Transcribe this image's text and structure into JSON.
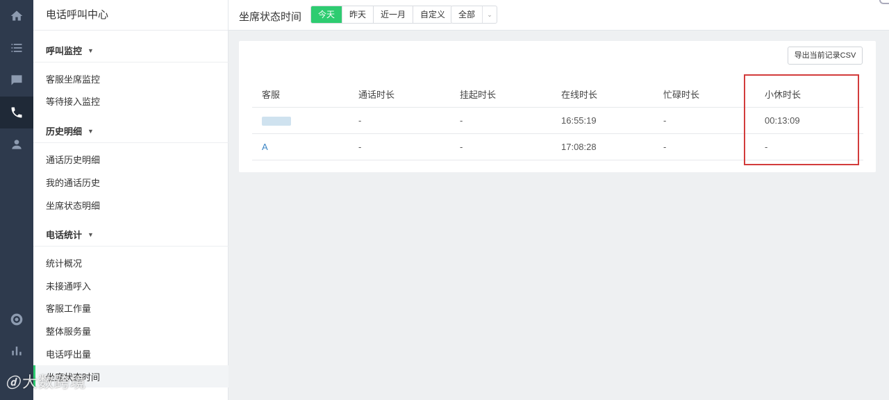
{
  "sidebar": {
    "title": "电话呼叫中心",
    "groups": [
      {
        "label": "呼叫监控",
        "items": [
          "客服坐席监控",
          "等待接入监控"
        ]
      },
      {
        "label": "历史明细",
        "items": [
          "通话历史明细",
          "我的通话历史",
          "坐席状态明细"
        ]
      },
      {
        "label": "电话统计",
        "items": [
          "统计概况",
          "未接通呼入",
          "客服工作量",
          "整体服务量",
          "电话呼出量",
          "坐席状态时间"
        ]
      }
    ]
  },
  "header": {
    "title": "坐席状态时间",
    "ranges": [
      "今天",
      "昨天",
      "近一月",
      "自定义"
    ],
    "selected_range": "今天",
    "filter_value": "全部"
  },
  "export_label": "导出当前记录CSV",
  "table": {
    "columns": [
      "客服",
      "通话时长",
      "挂起时长",
      "在线时长",
      "忙碌时长",
      "小休时长"
    ],
    "rows": [
      [
        "",
        "-",
        "-",
        "16:55:19",
        "-",
        "00:13:09"
      ],
      [
        "A",
        "-",
        "-",
        "17:08:28",
        "-",
        "-"
      ]
    ]
  },
  "highlight_color": "#d23b3b",
  "accent_color": "#2ecc71",
  "watermark": "大数跨境",
  "rail_icons": [
    "home-icon",
    "list-icon",
    "chat-icon",
    "phone-icon",
    "user-icon",
    "help-icon",
    "stats-icon"
  ]
}
